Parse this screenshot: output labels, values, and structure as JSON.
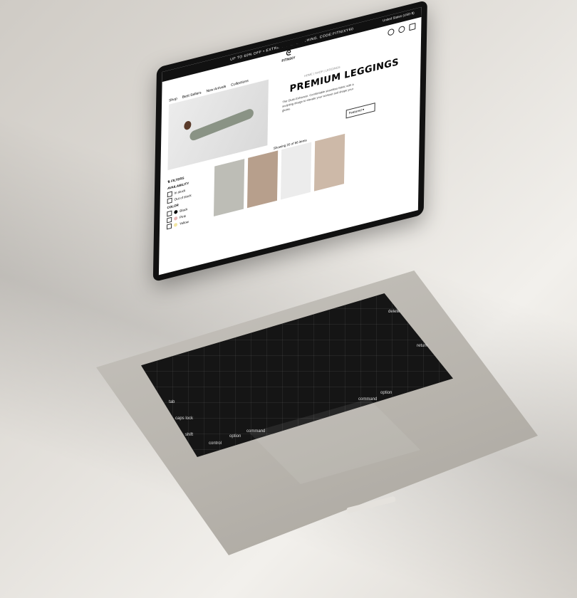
{
  "promo": "UP TO 60% OFF • EXTRA OFF EVERYTHING. CODE:FITNIXY60",
  "region": "United States (USD $)",
  "brand": {
    "name": "FITNIXY"
  },
  "nav": [
    "Shop",
    "Best Sellers",
    "New Arrivals",
    "Collections"
  ],
  "breadcrumb": "HOME | SHOP | LEGGINGS",
  "hero": {
    "title": "PREMIUM LEGGINGS",
    "description": "The Glute-Enhancer. Comfortable seamless fabric with a sculpting design to elevate your workout and shape your glutes."
  },
  "sort_label": "Featured",
  "showing": "Showing 20 of 66 items",
  "filters": {
    "title": "FILTERS",
    "availability": {
      "title": "AVAILABILITY",
      "items": [
        "In stock",
        "Out of stock"
      ]
    },
    "color": {
      "title": "COLOR",
      "items": [
        {
          "label": "Black",
          "color": "#000000"
        },
        {
          "label": "Pink",
          "color": "#e8b7b7"
        },
        {
          "label": "Yellow",
          "color": "#f2e6a3"
        }
      ]
    }
  },
  "keyboard": {
    "command": "command",
    "option": "option",
    "caps": "caps lock",
    "shift": "shift",
    "control": "control",
    "tab": "tab",
    "delete": "delete",
    "return": "return"
  }
}
